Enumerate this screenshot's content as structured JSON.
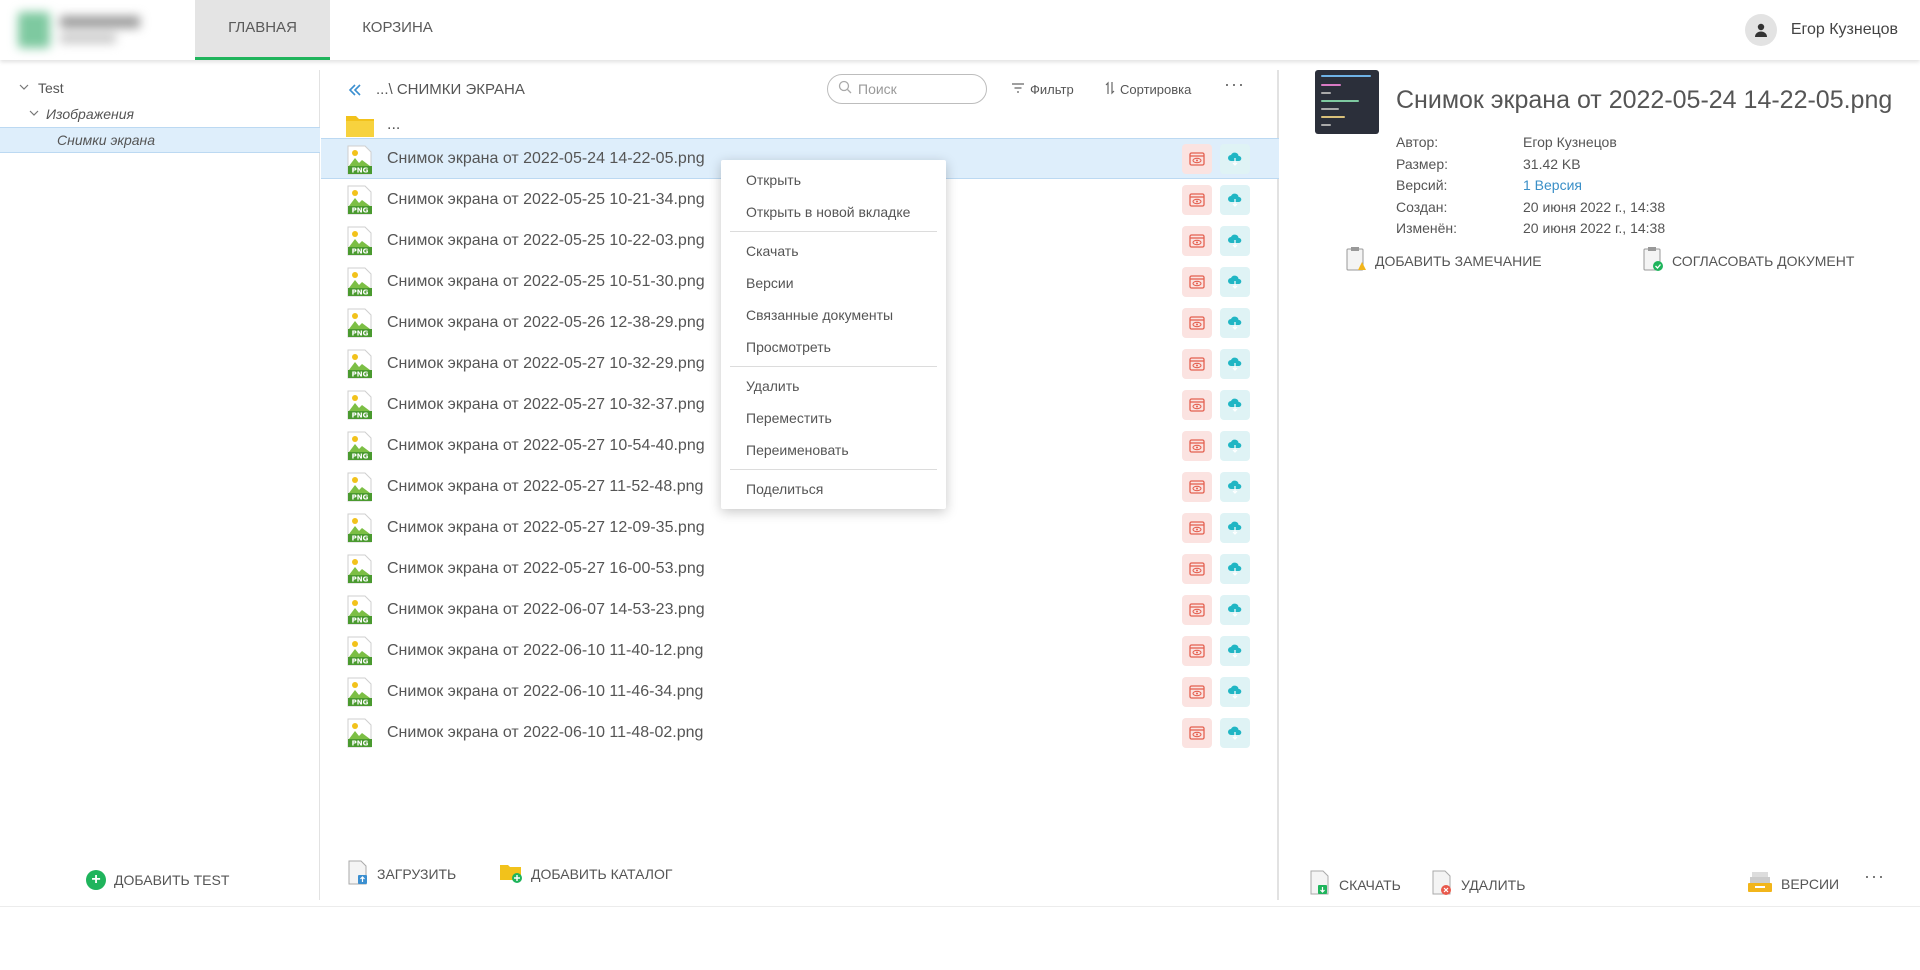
{
  "header": {
    "tabs": [
      {
        "label": "ГЛАВНАЯ",
        "active": true
      },
      {
        "label": "КОРЗИНА",
        "active": false
      }
    ],
    "user_name": "Егор Кузнецов",
    "icons": {
      "user": "user-icon"
    }
  },
  "tree": {
    "items": [
      {
        "label": "Test",
        "level": 0
      },
      {
        "label": "Изображения",
        "level": 1
      },
      {
        "label": "Снимки экрана",
        "level": 2,
        "selected": true
      }
    ],
    "add_label": "ДОБАВИТЬ TEST"
  },
  "toolbar": {
    "breadcrumb": "...\\ СНИМКИ ЭКРАНА",
    "search_placeholder": "Поиск",
    "filter_label": "Фильтр",
    "sort_label": "Сортировка",
    "more": "···"
  },
  "list": {
    "parent_label": "...",
    "files": [
      "Снимок экрана от 2022-05-24 14-22-05.png",
      "Снимок экрана от 2022-05-25 10-21-34.png",
      "Снимок экрана от 2022-05-25 10-22-03.png",
      "Снимок экрана от 2022-05-25 10-51-30.png",
      "Снимок экрана от 2022-05-26 12-38-29.png",
      "Снимок экрана от 2022-05-27 10-32-29.png",
      "Снимок экрана от 2022-05-27 10-32-37.png",
      "Снимок экрана от 2022-05-27 10-54-40.png",
      "Снимок экрана от 2022-05-27 11-52-48.png",
      "Снимок экрана от 2022-05-27 12-09-35.png",
      "Снимок экрана от 2022-05-27 16-00-53.png",
      "Снимок экрана от 2022-06-07 14-53-23.png",
      "Снимок экрана от 2022-06-10 11-40-12.png",
      "Снимок экрана от 2022-06-10 11-46-34.png",
      "Снимок экрана от 2022-06-10 11-48-02.png"
    ],
    "file_type_label": "PNG",
    "selected_index": 0,
    "upload_label": "ЗАГРУЗИТЬ",
    "add_folder_label": "ДОБАВИТЬ КАТАЛОГ"
  },
  "context_menu": {
    "groups": [
      [
        "Открыть",
        "Открыть в новой вкладке"
      ],
      [
        "Скачать",
        "Версии",
        "Связанные документы",
        "Просмотреть"
      ],
      [
        "Удалить",
        "Переместить",
        "Переименовать"
      ],
      [
        "Поделиться"
      ]
    ]
  },
  "details": {
    "title": "Снимок экрана от 2022-05-24 14-22-05.png",
    "meta": [
      {
        "key": "Автор:",
        "value": "Егор Кузнецов",
        "link": false
      },
      {
        "key": "Размер:",
        "value": "31.42 KB",
        "link": false
      },
      {
        "key": "Версий:",
        "value": "1 Версия",
        "link": true
      },
      {
        "key": "Создан:",
        "value": "20 июня 2022 г., 14:38",
        "link": false
      },
      {
        "key": "Изменён:",
        "value": "20 июня 2022 г., 14:38",
        "link": false
      }
    ],
    "add_note_label": "ДОБАВИТЬ ЗАМЕЧАНИЕ",
    "approve_label": "СОГЛАСОВАТЬ ДОКУМЕНТ",
    "download_label": "СКАЧАТЬ",
    "delete_label": "УДАЛИТЬ",
    "versions_label": "ВЕРСИИ",
    "more": "···"
  },
  "colors": {
    "accent_green": "#1fb45c",
    "selection": "#deeefb",
    "link": "#3a8fc7",
    "view_bg": "#fbe3e1",
    "cloud_bg": "#dff3f5"
  }
}
